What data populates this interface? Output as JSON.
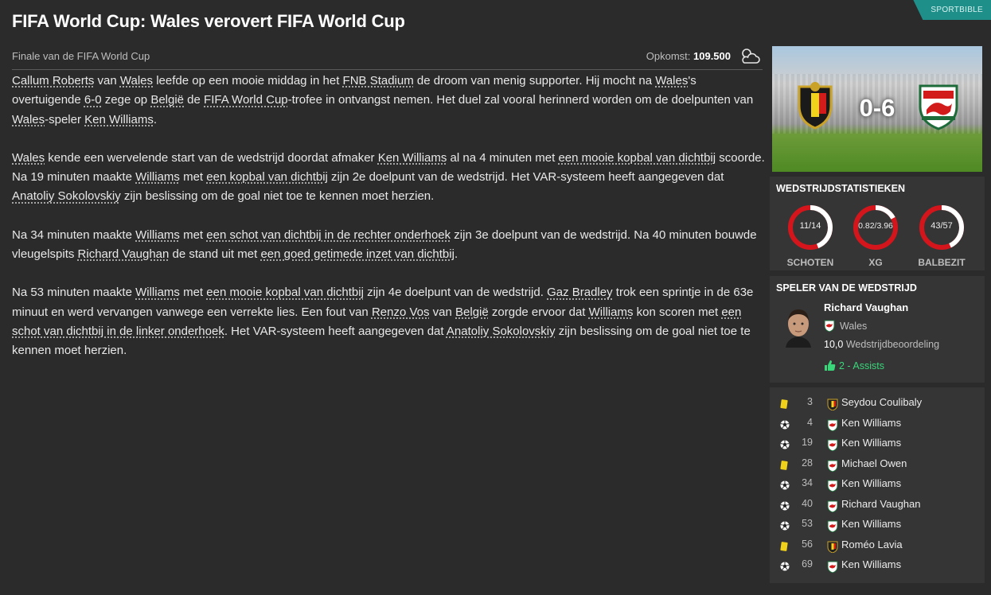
{
  "header": {
    "title": "FIFA World Cup: Wales verovert FIFA World Cup",
    "source_tag": "SPORTBIBLE",
    "subtitle": "Finale van de FIFA World Cup",
    "attendance_label": "Opkomst:",
    "attendance_value": "109.500",
    "weather_icon": "partly-cloudy-icon"
  },
  "article": {
    "p1": [
      {
        "t": "Callum Roberts",
        "link": true
      },
      {
        "t": " van "
      },
      {
        "t": "Wales",
        "link": true
      },
      {
        "t": " leefde op een mooie middag in het "
      },
      {
        "t": "FNB Stadium",
        "link": true
      },
      {
        "t": " de droom van menig supporter. Hij mocht na "
      },
      {
        "t": "Wales",
        "link": true
      },
      {
        "t": "'s overtuigende "
      },
      {
        "t": "6-0",
        "link": true
      },
      {
        "t": " zege op "
      },
      {
        "t": "België",
        "link": true
      },
      {
        "t": " de "
      },
      {
        "t": "FIFA World Cup",
        "link": true
      },
      {
        "t": "-trofee in ontvangst nemen. Het duel zal vooral herinnerd worden om de doelpunten van "
      },
      {
        "t": "Wales",
        "link": true
      },
      {
        "t": "-speler "
      },
      {
        "t": "Ken Williams",
        "link": true
      },
      {
        "t": "."
      }
    ],
    "p2": [
      {
        "t": "Wales",
        "link": true
      },
      {
        "t": " kende een wervelende start van de wedstrijd doordat afmaker "
      },
      {
        "t": "Ken Williams",
        "link": true
      },
      {
        "t": " al na 4 minuten met "
      },
      {
        "t": "een mooie kopbal van dichtbij",
        "link": true
      },
      {
        "t": " scoorde. Na 19 minuten maakte "
      },
      {
        "t": "Williams",
        "link": true
      },
      {
        "t": " met "
      },
      {
        "t": "een kopbal van dichtbij",
        "link": true
      },
      {
        "t": " zijn 2e doelpunt van de wedstrijd. Het VAR-systeem heeft aangegeven dat "
      },
      {
        "t": "Anatoliy Sokolovskiy",
        "link": true
      },
      {
        "t": " zijn beslissing om de goal niet toe te kennen moet herzien."
      }
    ],
    "p3": [
      {
        "t": "Na 34 minuten maakte "
      },
      {
        "t": "Williams",
        "link": true
      },
      {
        "t": " met "
      },
      {
        "t": "een schot van dichtbij in de rechter onderhoek",
        "link": true
      },
      {
        "t": " zijn 3e doelpunt van de wedstrijd. Na 40 minuten bouwde vleugelspits "
      },
      {
        "t": "Richard Vaughan",
        "link": true
      },
      {
        "t": " de stand uit met "
      },
      {
        "t": "een goed getimede inzet van dichtbij",
        "link": true
      },
      {
        "t": "."
      }
    ],
    "p4": [
      {
        "t": "Na 53 minuten maakte "
      },
      {
        "t": "Williams",
        "link": true
      },
      {
        "t": " met "
      },
      {
        "t": "een mooie kopbal van dichtbij",
        "link": true
      },
      {
        "t": " zijn 4e doelpunt van de wedstrijd. "
      },
      {
        "t": "Gaz Bradley",
        "link": true
      },
      {
        "t": " trok een sprintje in de 63e minuut en werd vervangen vanwege een verrekte lies. Een fout van "
      },
      {
        "t": "Renzo Vos",
        "link": true
      },
      {
        "t": " van "
      },
      {
        "t": "België",
        "link": true
      },
      {
        "t": " zorgde ervoor dat "
      },
      {
        "t": "Williams",
        "link": true
      },
      {
        "t": " kon scoren met "
      },
      {
        "t": "een schot van dichtbij in de linker onderhoek",
        "link": true
      },
      {
        "t": ". Het VAR-systeem heeft aangegeven dat "
      },
      {
        "t": "Anatoliy Sokolovskiy",
        "link": true
      },
      {
        "t": " zijn beslissing om de goal niet toe te kennen moet herzien."
      }
    ]
  },
  "match": {
    "score": "0-6",
    "home_crest": "belgium-crest-icon",
    "away_crest": "wales-crest-icon"
  },
  "stats": {
    "title": "WEDSTRIJDSTATISTIEKEN",
    "items": [
      {
        "value": "11/14",
        "label": "SCHOTEN",
        "home": 11,
        "away": 14
      },
      {
        "value": "0.82/3.96",
        "label": "XG",
        "home": 0.82,
        "away": 3.96
      },
      {
        "value": "43/57",
        "label": "BALBEZIT",
        "home": 43,
        "away": 57
      }
    ],
    "colors": {
      "home": "#ffffff",
      "away": "#d4161c"
    }
  },
  "potm": {
    "title": "SPELER VAN DE WEDSTRIJD",
    "name": "Richard Vaughan",
    "team": "Wales",
    "rating": "10,0",
    "rating_label": "Wedstrijdbeoordeling",
    "assists": "2 - Assists"
  },
  "events": [
    {
      "type": "yellow-card",
      "minute": "3",
      "team": "belgium",
      "player": "Seydou Coulibaly"
    },
    {
      "type": "goal",
      "minute": "4",
      "team": "wales",
      "player": "Ken Williams"
    },
    {
      "type": "goal",
      "minute": "19",
      "team": "wales",
      "player": "Ken Williams"
    },
    {
      "type": "yellow-card",
      "minute": "28",
      "team": "wales",
      "player": "Michael Owen"
    },
    {
      "type": "goal",
      "minute": "34",
      "team": "wales",
      "player": "Ken Williams"
    },
    {
      "type": "goal",
      "minute": "40",
      "team": "wales",
      "player": "Richard Vaughan"
    },
    {
      "type": "goal",
      "minute": "53",
      "team": "wales",
      "player": "Ken Williams"
    },
    {
      "type": "yellow-card",
      "minute": "56",
      "team": "belgium",
      "player": "Roméo Lavia"
    },
    {
      "type": "goal",
      "minute": "69",
      "team": "wales",
      "player": "Ken Williams"
    }
  ]
}
